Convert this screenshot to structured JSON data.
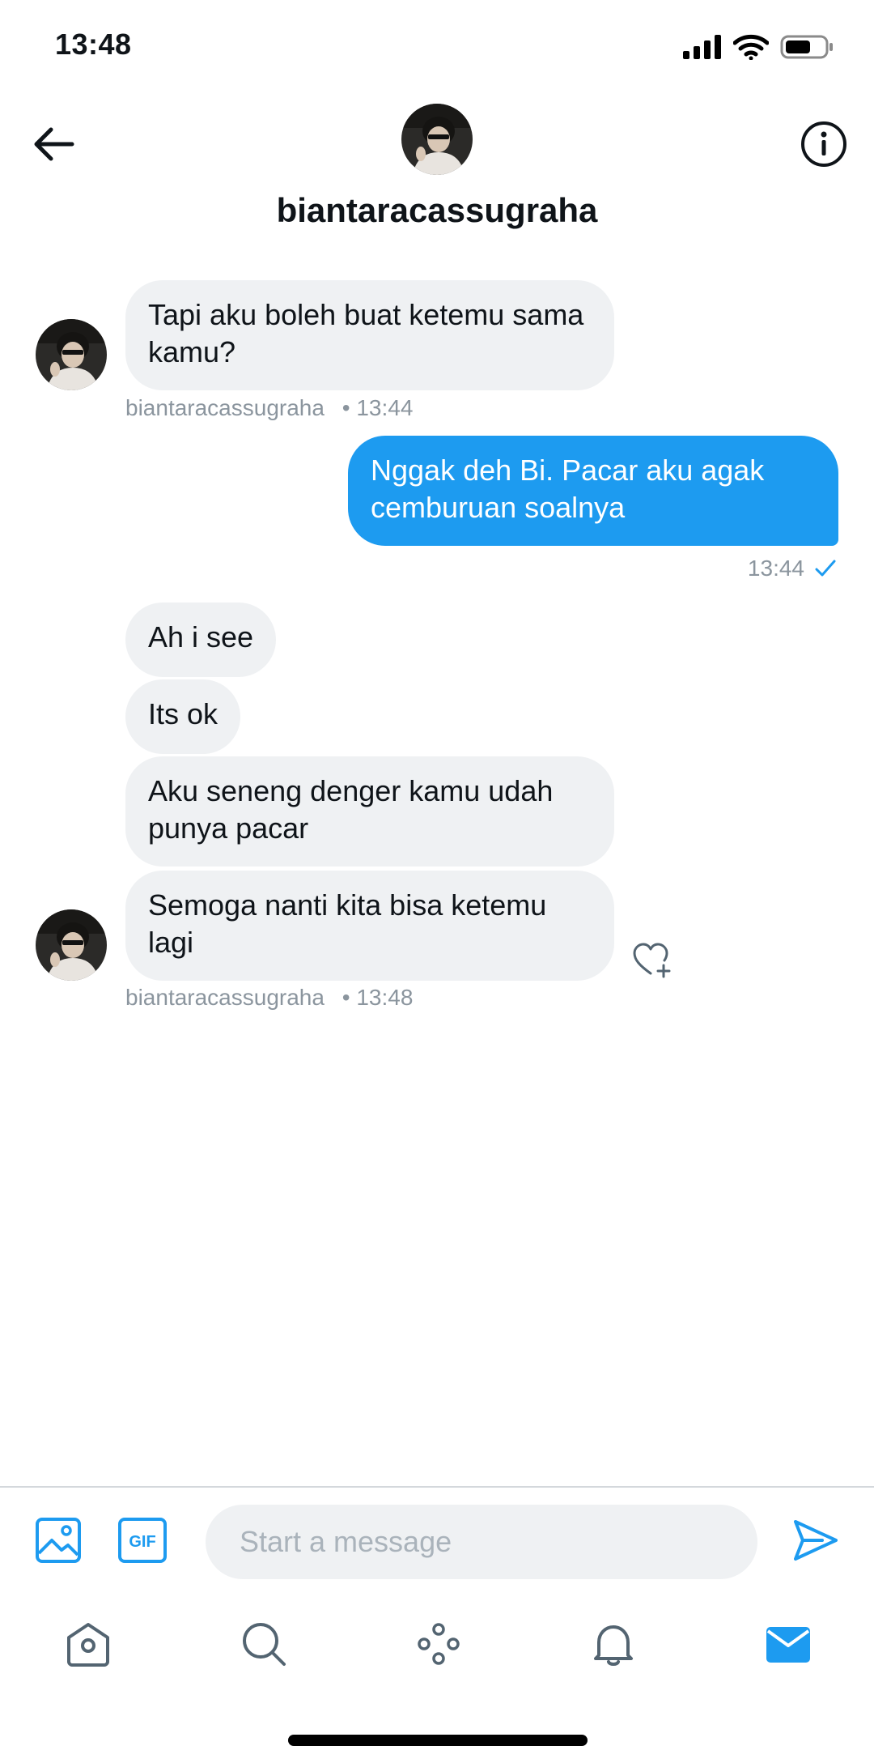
{
  "status_bar": {
    "time": "13:48"
  },
  "header": {
    "username": "biantaracassugraha"
  },
  "messages": [
    {
      "text": "Tapi aku boleh buat ketemu sama kamu?"
    },
    {
      "text": "Nggak deh Bi. Pacar aku agak cemburuan soalnya"
    },
    {
      "text": "Ah i see"
    },
    {
      "text": "Its ok"
    },
    {
      "text": "Aku seneng denger kamu udah punya pacar"
    },
    {
      "text": "Semoga nanti kita bisa ketemu lagi"
    }
  ],
  "meta": {
    "group1_sender": "biantaracassugraha",
    "group1_time": "• 13:44",
    "sent_time": "13:44",
    "group2_sender": "biantaracassugraha",
    "group2_time": "• 13:48"
  },
  "composer": {
    "placeholder": "Start a message",
    "gif_label": "GIF"
  },
  "colors": {
    "accent": "#1d9bf0",
    "incoming_bubble": "#eff1f3",
    "meta_text": "#8b959e"
  },
  "icons": [
    "back-arrow-icon",
    "info-icon",
    "image-icon",
    "gif-icon",
    "send-icon",
    "home-icon",
    "search-icon",
    "spaces-icon",
    "bell-icon",
    "mail-icon",
    "heart-plus-icon",
    "check-icon"
  ]
}
